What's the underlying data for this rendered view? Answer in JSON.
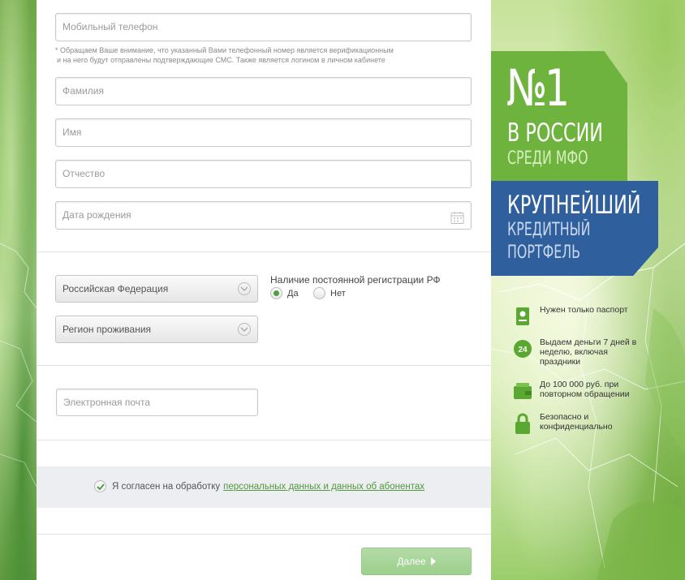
{
  "form": {
    "phone_placeholder": "Мобильный телефон",
    "phone_note_line1": "* Обращаем Ваше внимание, что указанный Вами телефонный номер является верификационным",
    "phone_note_line2": "и на него будут отправлены подтверждающие СМС. Также является логином в личном кабинете",
    "lastname_placeholder": "Фамилия",
    "firstname_placeholder": "Имя",
    "middlename_placeholder": "Отчество",
    "birthdate_placeholder": "Дата рождения",
    "country_value": "Российская Федерация",
    "region_value": "Регион проживания",
    "registration_label": "Наличие постоянной регистрации РФ",
    "registration_yes": "Да",
    "registration_no": "Нет",
    "registration_selected": "Да",
    "email_placeholder": "Электронная почта",
    "consent_text": "Я согласен на обработку",
    "consent_link": "персональных данных и данных об абонентах",
    "consent_checked": true,
    "next_label": "Далее"
  },
  "banner": {
    "rank": "№1",
    "rank_line2": "В РОССИИ",
    "rank_line3": "СРЕДИ МФО",
    "portfolio_line1": "КРУПНЕЙШИЙ",
    "portfolio_line2": "КРЕДИТНЫЙ",
    "portfolio_line3": "ПОРТФЕЛЬ",
    "green_color": "#6fb33f",
    "blue_color": "#2f5f9c",
    "features": [
      {
        "icon": "passport-icon",
        "text": "Нужен только паспорт"
      },
      {
        "icon": "24-hours-icon",
        "text": "Выдаем деньги 7 дней в неделю, включая праздники"
      },
      {
        "icon": "wallet-icon",
        "text": "До 100 000 руб. при повторном обращении"
      },
      {
        "icon": "lock-icon",
        "text": "Безопасно и конфиденциально"
      }
    ]
  }
}
